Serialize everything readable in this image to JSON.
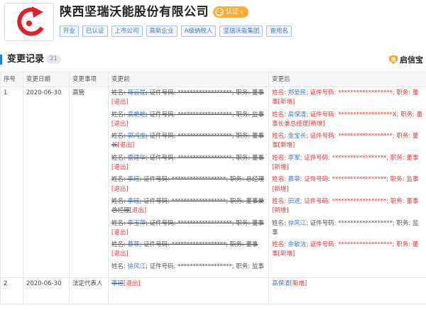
{
  "company": {
    "name": "陕西坚瑞沃能股份有限公司",
    "verify_label": "认证",
    "verify_arrow": "›",
    "tags": [
      "开业",
      "已认证",
      "上市公司",
      "高新企业",
      "A级纳税人",
      "坚瑞沃能集团",
      "曾用名"
    ]
  },
  "section": {
    "title": "变更记录",
    "count": "21",
    "brand": "启信宝"
  },
  "table": {
    "headers": [
      "序号",
      "变更日期",
      "变更事项",
      "变更前",
      "变更后"
    ],
    "rows": [
      {
        "index": "1",
        "date": "2020-06-30",
        "item": "高管",
        "before": [
          {
            "prefix": "姓名: ",
            "name": "蒋云昆",
            "mid": "; 证件号码: ******************; 职务: 董事",
            "tag": "[退出]"
          },
          {
            "prefix": "姓名: ",
            "name": "高艳艳",
            "mid": "; 证件号码: ******************; 职务: 监事",
            "tag": "[退出]"
          },
          {
            "prefix": "姓名: ",
            "name": "郭鸿宝",
            "mid": "; 证件号码: ******************; 职务: 董事长",
            "tag": "[退出]"
          },
          {
            "prefix": "姓名: ",
            "name": "雷建华",
            "mid": "; 证件号码: ******************; 职务: 董事",
            "tag": "[退出]"
          },
          {
            "prefix": "姓名: ",
            "name": "李瑶",
            "mid": "; 证件号码: ******************; 职务: 总经理",
            "tag": "[退出]"
          },
          {
            "prefix": "姓名: ",
            "name": "李瑶",
            "mid": "; 证件号码: ******************; 职务: 董事兼总经理",
            "tag": "[退出]"
          },
          {
            "prefix": "姓名: ",
            "name": "李玉萍",
            "mid": "; 证件号码: ******************; 职务: 董事",
            "tag": "[退出]"
          },
          {
            "prefix": "姓名: ",
            "name": "慕菲",
            "mid": "; 证件号码: ******************; 职务: 董事",
            "tag": "[退出]"
          },
          {
            "prefix": "姓名: ",
            "name": "徐风江",
            "mid": "; 证件号码: ******************; 职务: 监事",
            "tag": ""
          }
        ],
        "after": [
          {
            "prefix": "姓名: ",
            "name": "郑爱民",
            "mid": "; 证件号码: ******************; 职务: 董事",
            "tag": "[新增]"
          },
          {
            "prefix": "姓名: ",
            "name": "高保清",
            "mid": "; 证件号码: ******************X; 职务: 董事长兼总经理",
            "tag": "[新增]"
          },
          {
            "prefix": "姓名: ",
            "name": "金宝长",
            "mid": "; 证件号码: ******************; 职务: 董事",
            "tag": "[新增]"
          },
          {
            "prefix": "姓名: ",
            "name": "李军",
            "mid": "; 证件号码: ******************; 职务: 董事",
            "tag": "[新增]"
          },
          {
            "prefix": "姓名: ",
            "name": "慕菲",
            "mid": "; 证件号码: ******************; 职务: 监事",
            "tag": "[新增]"
          },
          {
            "prefix": "姓名: ",
            "name": "田进",
            "mid": "; 证件号码: ******************; 职务: 董事",
            "tag": "[新增]"
          },
          {
            "prefix": "姓名: ",
            "name": "徐风江",
            "mid": "; 证件号码: ******************; 职务: 监事",
            "tag": ""
          },
          {
            "prefix": "姓名: ",
            "name": "余敏洁",
            "mid": "; 证件号码: ******************; 职务: 董事",
            "tag": "[新增]"
          }
        ]
      },
      {
        "index": "2",
        "date": "2020-06-30",
        "item": "法定代表人",
        "before": [
          {
            "prefix": "",
            "name": "李瑶",
            "mid": "",
            "tag": "[退出]"
          }
        ],
        "after": [
          {
            "prefix": "",
            "name": "高保清",
            "mid": "",
            "tag": "[新增]"
          }
        ]
      }
    ]
  }
}
